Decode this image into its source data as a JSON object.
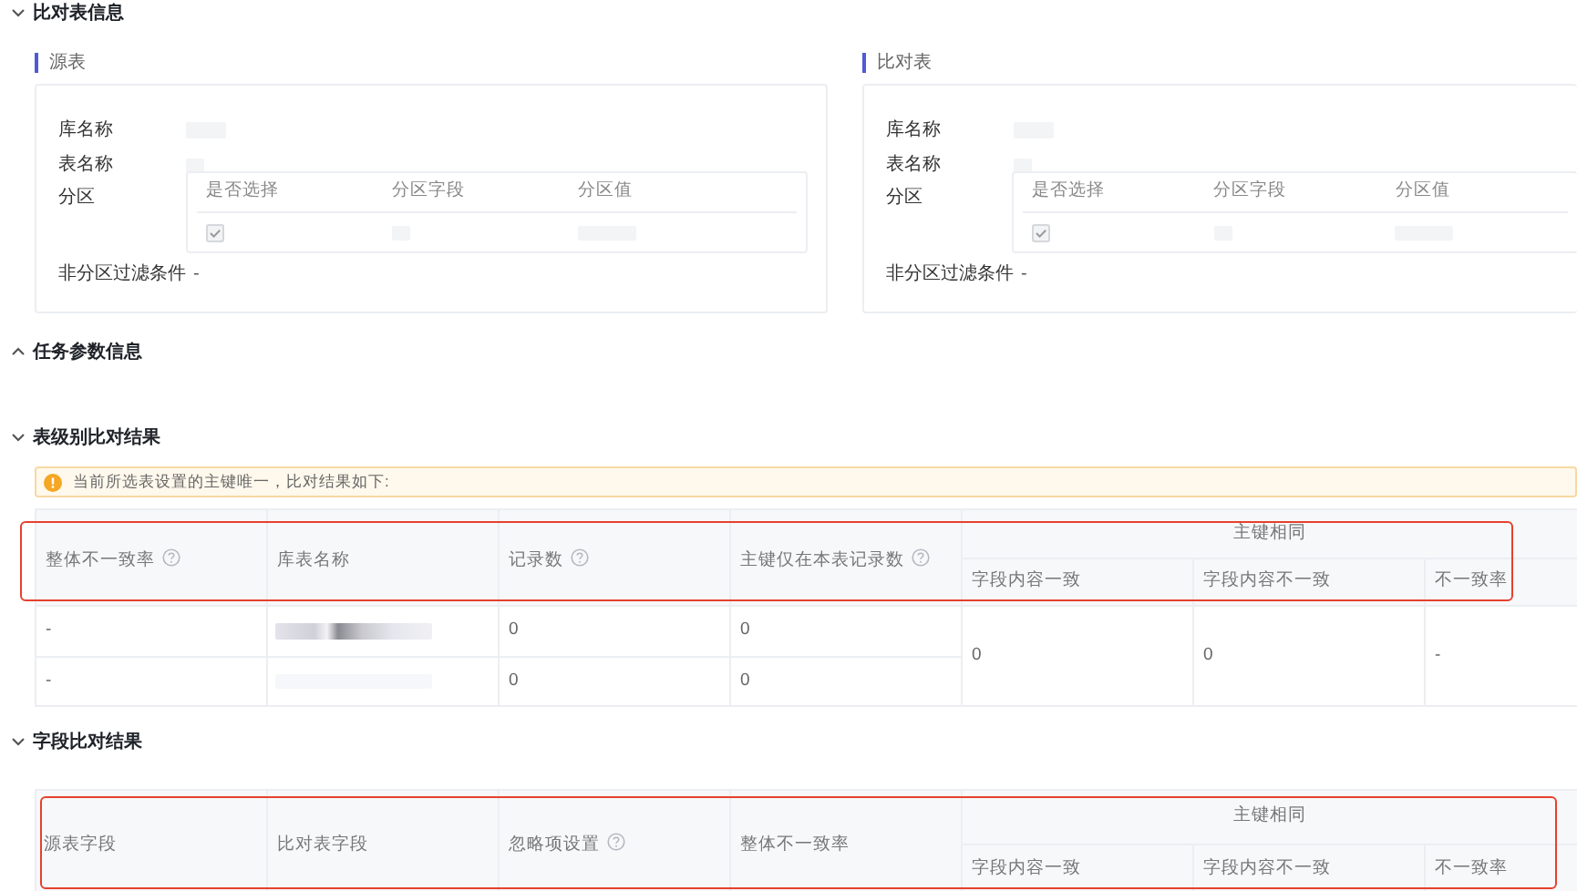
{
  "sections": [
    {
      "kind": "compare_info",
      "title": "比对表信息",
      "expanded": true,
      "panels": [
        {
          "title": "源表",
          "fields": [
            {
              "label": "库名称"
            },
            {
              "label": "表名称"
            }
          ],
          "partition": {
            "label": "分区",
            "columns": [
              "是否选择",
              "分区字段",
              "分区值"
            ],
            "rows": [
              {
                "checked": true,
                "disabled": true
              }
            ]
          },
          "filter": {
            "label": "非分区过滤条件",
            "value": "-"
          }
        },
        {
          "title": "比对表",
          "fields": [
            {
              "label": "库名称"
            },
            {
              "label": "表名称"
            }
          ],
          "partition": {
            "label": "分区",
            "columns": [
              "是否选择",
              "分区字段",
              "分区值"
            ],
            "rows": [
              {
                "checked": true,
                "disabled": true
              }
            ]
          },
          "filter": {
            "label": "非分区过滤条件",
            "value": "-"
          }
        }
      ]
    },
    {
      "kind": "params",
      "title": "任务参数信息",
      "expanded": false
    },
    {
      "kind": "table_result",
      "title": "表级别比对结果",
      "expanded": true,
      "alert": "当前所选表设置的主键唯一，比对结果如下:",
      "table": {
        "highlighted": true,
        "columns": [
          {
            "label": "整体不一致率",
            "help": true
          },
          {
            "label": "库表名称",
            "help": false
          },
          {
            "label": "记录数",
            "help": true
          },
          {
            "label": "主键仅在本表记录数",
            "help": true
          }
        ],
        "group": {
          "label": "主键相同",
          "columns": [
            "字段内容一致",
            "字段内容不一致",
            "不一致率"
          ]
        },
        "rows": [
          {
            "overall": "-",
            "records": "0",
            "pk_only": "0"
          },
          {
            "overall": "-",
            "records": "0",
            "pk_only": "0"
          }
        ],
        "group_values": [
          "0",
          "0",
          "-"
        ]
      }
    },
    {
      "kind": "field_result",
      "title": "字段比对结果",
      "expanded": true,
      "table": {
        "highlighted": true,
        "columns": [
          {
            "label": "源表字段",
            "help": false
          },
          {
            "label": "比对表字段",
            "help": false
          },
          {
            "label": "忽略项设置",
            "help": true
          },
          {
            "label": "整体不一致率",
            "help": false
          }
        ],
        "group": {
          "label": "主键相同",
          "columns": [
            "字段内容一致",
            "字段内容不一致",
            "不一致率"
          ]
        }
      }
    }
  ]
}
